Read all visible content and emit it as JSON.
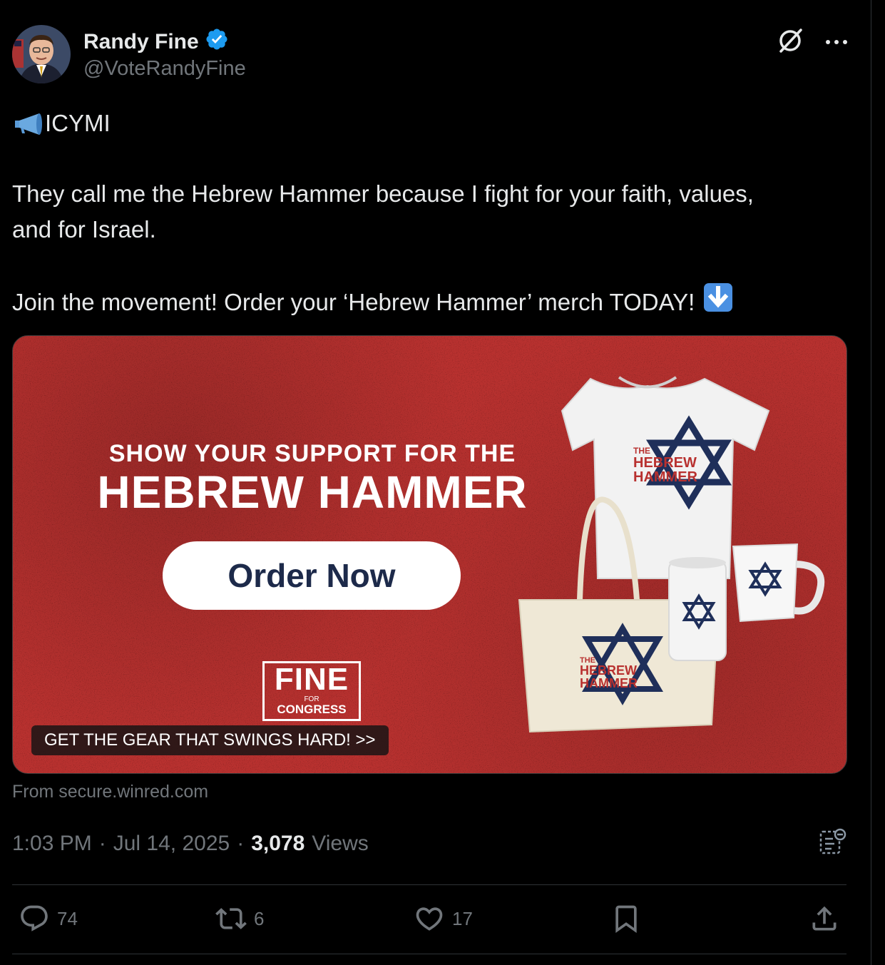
{
  "author": {
    "name": "Randy Fine",
    "handle": "@VoteRandyFine"
  },
  "tweet": {
    "line1": "ICYMI",
    "line2": "They call me the Hebrew Hammer because I fight for your faith, values,",
    "line3": "and for Israel.",
    "line4": "Join the movement! Order your ‘Hebrew Hammer’ merch TODAY!"
  },
  "card": {
    "headline_small": "SHOW YOUR SUPPORT FOR THE",
    "headline_big": "HEBREW HAMMER",
    "button": "Order Now",
    "logo_fine": "FINE",
    "logo_for": "FOR",
    "logo_congress": "CONGRESS",
    "merch_the": "THE",
    "merch_hebrew": "HEBREW",
    "merch_hammer": "HAMMER",
    "caption": "GET THE GEAR THAT SWINGS HARD! >>",
    "source": "From secure.winred.com"
  },
  "meta": {
    "time": "1:03 PM",
    "sep1": "·",
    "date": "Jul 14, 2025",
    "sep2": "·",
    "views_count": "3,078",
    "views_label": "Views"
  },
  "actions": {
    "replies": "74",
    "reposts": "6",
    "likes": "17"
  },
  "colors": {
    "background": "#000000",
    "text": "#e7e9ea",
    "muted": "#71767b",
    "verified": "#1d9bf0",
    "card_red": "#b8312f",
    "navy": "#1d2a4a"
  },
  "icons": [
    "megaphone-icon",
    "verified-badge-icon",
    "grok-icon",
    "more-icon",
    "arrow-down-emoji-icon",
    "reply-icon",
    "repost-icon",
    "like-icon",
    "bookmark-icon",
    "share-icon",
    "analytics-icon"
  ]
}
